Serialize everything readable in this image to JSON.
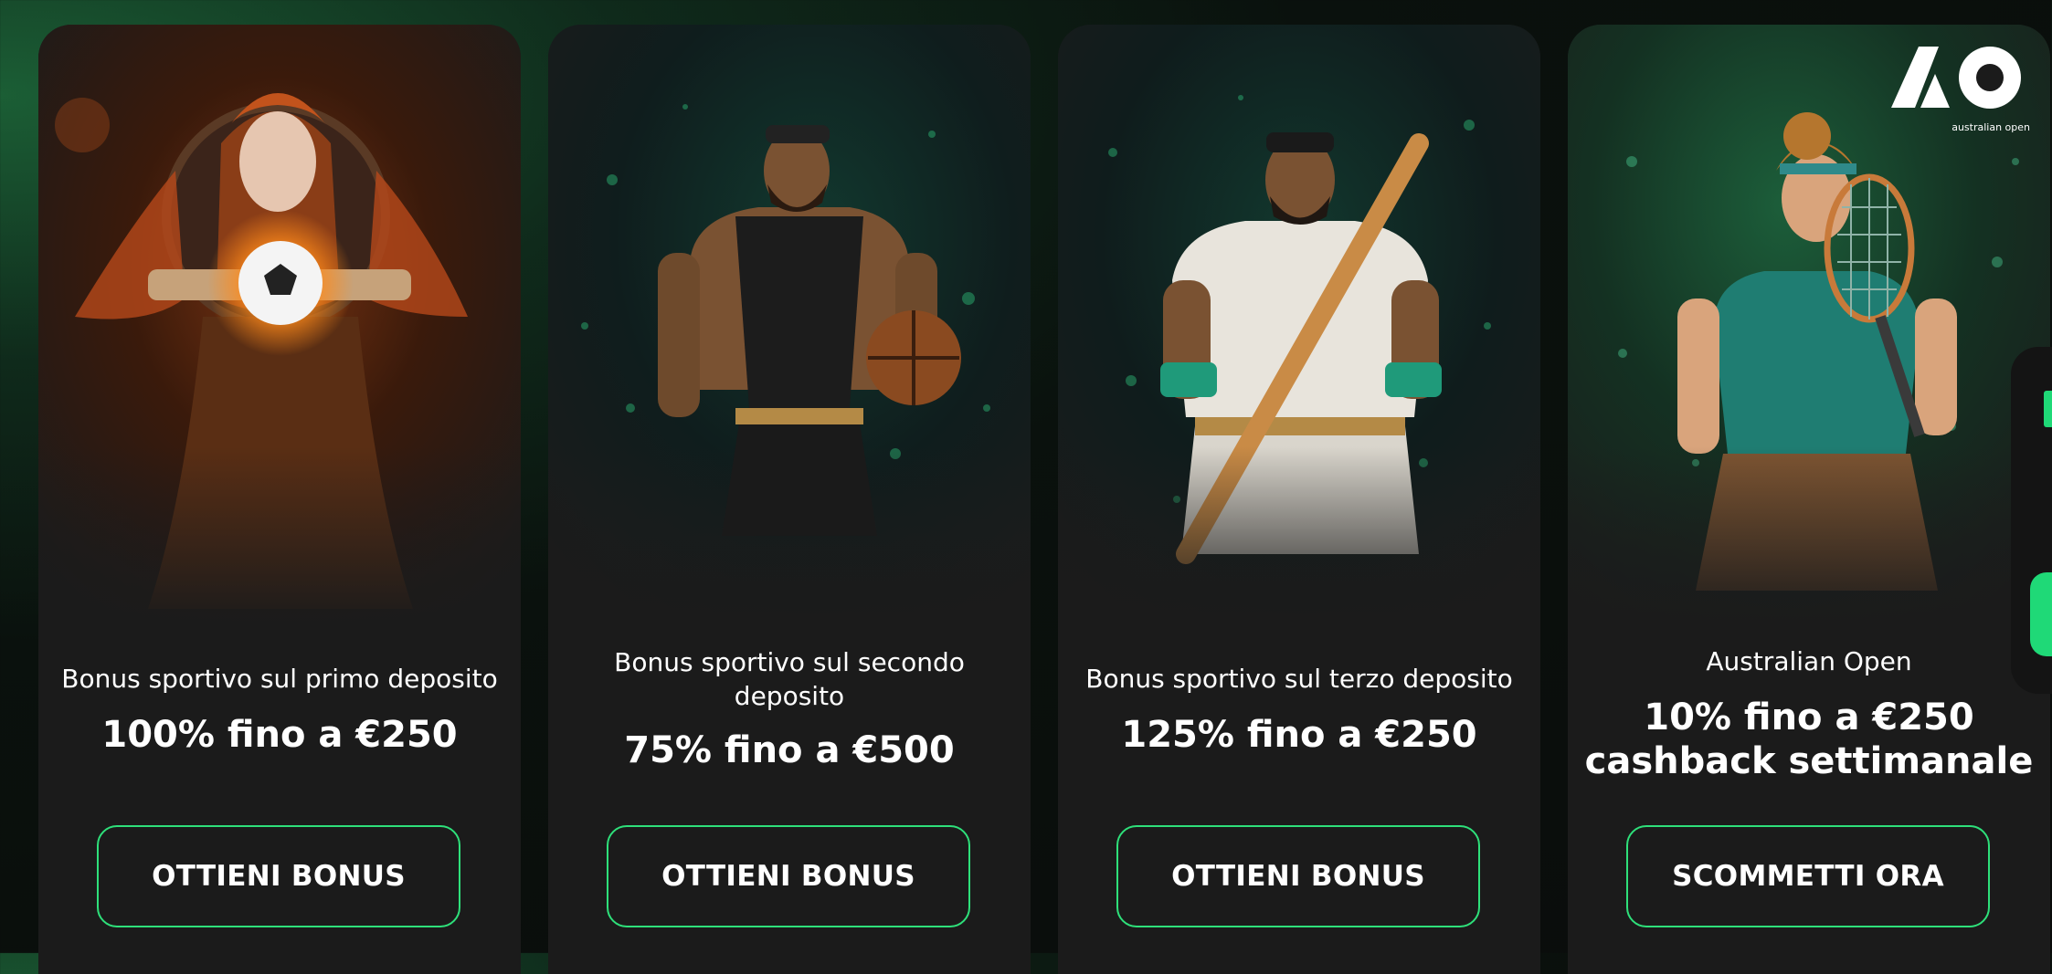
{
  "cards": [
    {
      "id": "first",
      "subtitle": "Bonus sportivo sul primo deposito",
      "headline": "100% fino a €250",
      "button": "OTTIENI BONUS",
      "art_icon": "soccer-warrior-illustration"
    },
    {
      "id": "second",
      "subtitle": "Bonus sportivo sul secondo deposito",
      "headline": "75% fino a €500",
      "button": "OTTIENI BONUS",
      "art_icon": "basketball-warrior-illustration"
    },
    {
      "id": "third",
      "subtitle": "Bonus sportivo sul terzo deposito",
      "headline": "125% fino a €250",
      "button": "OTTIENI BONUS",
      "art_icon": "baseball-warrior-illustration"
    },
    {
      "id": "fourth",
      "subtitle": "Australian Open",
      "headline": "10% fino a €250 cashback settimanale",
      "button": "SCOMMETTI ORA",
      "art_icon": "tennis-player-illustration",
      "logo_text": "australian open",
      "logo_mark": "AO"
    }
  ],
  "colors": {
    "accent": "#2ee07a",
    "card_bg": "#1b1b1b",
    "page_bg": "#0a0c0b"
  }
}
